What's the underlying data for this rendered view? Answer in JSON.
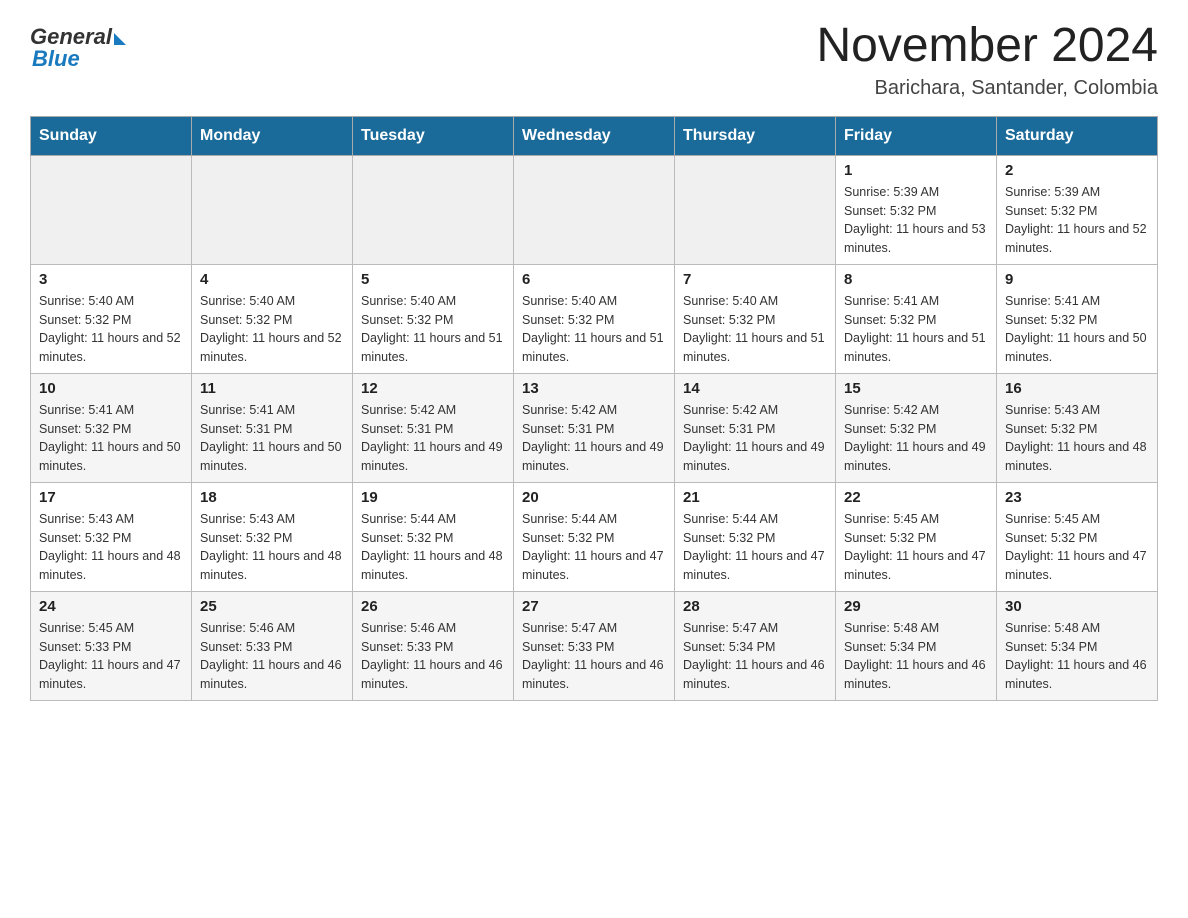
{
  "header": {
    "logo_general": "General",
    "logo_blue": "Blue",
    "title": "November 2024",
    "subtitle": "Barichara, Santander, Colombia"
  },
  "weekdays": [
    "Sunday",
    "Monday",
    "Tuesday",
    "Wednesday",
    "Thursday",
    "Friday",
    "Saturday"
  ],
  "rows": [
    {
      "days": [
        {
          "number": "",
          "sunrise": "",
          "sunset": "",
          "daylight": ""
        },
        {
          "number": "",
          "sunrise": "",
          "sunset": "",
          "daylight": ""
        },
        {
          "number": "",
          "sunrise": "",
          "sunset": "",
          "daylight": ""
        },
        {
          "number": "",
          "sunrise": "",
          "sunset": "",
          "daylight": ""
        },
        {
          "number": "",
          "sunrise": "",
          "sunset": "",
          "daylight": ""
        },
        {
          "number": "1",
          "sunrise": "Sunrise: 5:39 AM",
          "sunset": "Sunset: 5:32 PM",
          "daylight": "Daylight: 11 hours and 53 minutes."
        },
        {
          "number": "2",
          "sunrise": "Sunrise: 5:39 AM",
          "sunset": "Sunset: 5:32 PM",
          "daylight": "Daylight: 11 hours and 52 minutes."
        }
      ]
    },
    {
      "days": [
        {
          "number": "3",
          "sunrise": "Sunrise: 5:40 AM",
          "sunset": "Sunset: 5:32 PM",
          "daylight": "Daylight: 11 hours and 52 minutes."
        },
        {
          "number": "4",
          "sunrise": "Sunrise: 5:40 AM",
          "sunset": "Sunset: 5:32 PM",
          "daylight": "Daylight: 11 hours and 52 minutes."
        },
        {
          "number": "5",
          "sunrise": "Sunrise: 5:40 AM",
          "sunset": "Sunset: 5:32 PM",
          "daylight": "Daylight: 11 hours and 51 minutes."
        },
        {
          "number": "6",
          "sunrise": "Sunrise: 5:40 AM",
          "sunset": "Sunset: 5:32 PM",
          "daylight": "Daylight: 11 hours and 51 minutes."
        },
        {
          "number": "7",
          "sunrise": "Sunrise: 5:40 AM",
          "sunset": "Sunset: 5:32 PM",
          "daylight": "Daylight: 11 hours and 51 minutes."
        },
        {
          "number": "8",
          "sunrise": "Sunrise: 5:41 AM",
          "sunset": "Sunset: 5:32 PM",
          "daylight": "Daylight: 11 hours and 51 minutes."
        },
        {
          "number": "9",
          "sunrise": "Sunrise: 5:41 AM",
          "sunset": "Sunset: 5:32 PM",
          "daylight": "Daylight: 11 hours and 50 minutes."
        }
      ]
    },
    {
      "days": [
        {
          "number": "10",
          "sunrise": "Sunrise: 5:41 AM",
          "sunset": "Sunset: 5:32 PM",
          "daylight": "Daylight: 11 hours and 50 minutes."
        },
        {
          "number": "11",
          "sunrise": "Sunrise: 5:41 AM",
          "sunset": "Sunset: 5:31 PM",
          "daylight": "Daylight: 11 hours and 50 minutes."
        },
        {
          "number": "12",
          "sunrise": "Sunrise: 5:42 AM",
          "sunset": "Sunset: 5:31 PM",
          "daylight": "Daylight: 11 hours and 49 minutes."
        },
        {
          "number": "13",
          "sunrise": "Sunrise: 5:42 AM",
          "sunset": "Sunset: 5:31 PM",
          "daylight": "Daylight: 11 hours and 49 minutes."
        },
        {
          "number": "14",
          "sunrise": "Sunrise: 5:42 AM",
          "sunset": "Sunset: 5:31 PM",
          "daylight": "Daylight: 11 hours and 49 minutes."
        },
        {
          "number": "15",
          "sunrise": "Sunrise: 5:42 AM",
          "sunset": "Sunset: 5:32 PM",
          "daylight": "Daylight: 11 hours and 49 minutes."
        },
        {
          "number": "16",
          "sunrise": "Sunrise: 5:43 AM",
          "sunset": "Sunset: 5:32 PM",
          "daylight": "Daylight: 11 hours and 48 minutes."
        }
      ]
    },
    {
      "days": [
        {
          "number": "17",
          "sunrise": "Sunrise: 5:43 AM",
          "sunset": "Sunset: 5:32 PM",
          "daylight": "Daylight: 11 hours and 48 minutes."
        },
        {
          "number": "18",
          "sunrise": "Sunrise: 5:43 AM",
          "sunset": "Sunset: 5:32 PM",
          "daylight": "Daylight: 11 hours and 48 minutes."
        },
        {
          "number": "19",
          "sunrise": "Sunrise: 5:44 AM",
          "sunset": "Sunset: 5:32 PM",
          "daylight": "Daylight: 11 hours and 48 minutes."
        },
        {
          "number": "20",
          "sunrise": "Sunrise: 5:44 AM",
          "sunset": "Sunset: 5:32 PM",
          "daylight": "Daylight: 11 hours and 47 minutes."
        },
        {
          "number": "21",
          "sunrise": "Sunrise: 5:44 AM",
          "sunset": "Sunset: 5:32 PM",
          "daylight": "Daylight: 11 hours and 47 minutes."
        },
        {
          "number": "22",
          "sunrise": "Sunrise: 5:45 AM",
          "sunset": "Sunset: 5:32 PM",
          "daylight": "Daylight: 11 hours and 47 minutes."
        },
        {
          "number": "23",
          "sunrise": "Sunrise: 5:45 AM",
          "sunset": "Sunset: 5:32 PM",
          "daylight": "Daylight: 11 hours and 47 minutes."
        }
      ]
    },
    {
      "days": [
        {
          "number": "24",
          "sunrise": "Sunrise: 5:45 AM",
          "sunset": "Sunset: 5:33 PM",
          "daylight": "Daylight: 11 hours and 47 minutes."
        },
        {
          "number": "25",
          "sunrise": "Sunrise: 5:46 AM",
          "sunset": "Sunset: 5:33 PM",
          "daylight": "Daylight: 11 hours and 46 minutes."
        },
        {
          "number": "26",
          "sunrise": "Sunrise: 5:46 AM",
          "sunset": "Sunset: 5:33 PM",
          "daylight": "Daylight: 11 hours and 46 minutes."
        },
        {
          "number": "27",
          "sunrise": "Sunrise: 5:47 AM",
          "sunset": "Sunset: 5:33 PM",
          "daylight": "Daylight: 11 hours and 46 minutes."
        },
        {
          "number": "28",
          "sunrise": "Sunrise: 5:47 AM",
          "sunset": "Sunset: 5:34 PM",
          "daylight": "Daylight: 11 hours and 46 minutes."
        },
        {
          "number": "29",
          "sunrise": "Sunrise: 5:48 AM",
          "sunset": "Sunset: 5:34 PM",
          "daylight": "Daylight: 11 hours and 46 minutes."
        },
        {
          "number": "30",
          "sunrise": "Sunrise: 5:48 AM",
          "sunset": "Sunset: 5:34 PM",
          "daylight": "Daylight: 11 hours and 46 minutes."
        }
      ]
    }
  ]
}
